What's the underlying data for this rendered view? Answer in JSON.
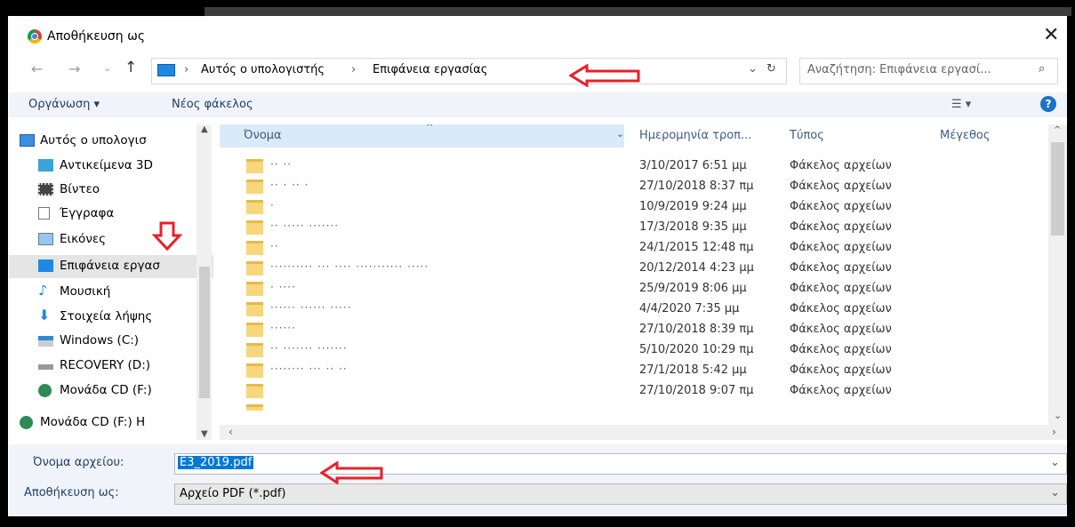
{
  "window": {
    "title": "Αποθήκευση ως"
  },
  "nav": {
    "path": [
      "Αυτός ο υπολογιστής",
      "Επιφάνεια εργασίας"
    ],
    "search_placeholder": "Αναζήτηση: Επιφάνεια εργασί..."
  },
  "toolbar": {
    "organize_label": "Οργάνωση ▾",
    "new_folder_label": "Νέος φάκελος"
  },
  "sidebar": {
    "items": [
      {
        "label": "Αυτός ο υπολογισ",
        "icon": "computer-icon"
      },
      {
        "label": "Αντικείμενα 3D",
        "icon": "cube-3d-icon"
      },
      {
        "label": "Βίντεο",
        "icon": "film-icon"
      },
      {
        "label": "Έγγραφα",
        "icon": "document-icon"
      },
      {
        "label": "Εικόνες",
        "icon": "picture-icon"
      },
      {
        "label": "Επιφάνεια εργασ",
        "icon": "desktop-icon"
      },
      {
        "label": "Μουσική",
        "icon": "music-icon"
      },
      {
        "label": "Στοιχεία λήψης",
        "icon": "download-icon"
      },
      {
        "label": "Windows (C:)",
        "icon": "windows-drive-icon"
      },
      {
        "label": "RECOVERY (D:)",
        "icon": "drive-icon"
      },
      {
        "label": "Μονάδα CD (F:)",
        "icon": "cd-drive-icon"
      },
      {
        "label": "Μονάδα CD (F:) H",
        "icon": "cd-drive-icon"
      }
    ]
  },
  "list": {
    "columns": [
      "Όνομα",
      "Ημερομηνία τροπ...",
      "Τύπος",
      "Μέγεθος"
    ],
    "rows": [
      {
        "name": "·· ··",
        "date": "3/10/2017 6:51 μμ",
        "type": "Φάκελος αρχείων"
      },
      {
        "name": "·· ·  ·· ·",
        "date": "27/10/2018 8:37 πμ",
        "type": "Φάκελος αρχείων"
      },
      {
        "name": "·",
        "date": "10/9/2019 9:24 μμ",
        "type": "Φάκελος αρχείων"
      },
      {
        "name": "·· ····· ·······",
        "date": "17/3/2018 9:35 μμ",
        "type": "Φάκελος αρχείων"
      },
      {
        "name": "··",
        "date": "24/1/2015 12:48 πμ",
        "type": "Φάκελος αρχείων"
      },
      {
        "name": "·········· ··· ···· ··········· ·····",
        "date": "20/12/2014 4:23 μμ",
        "type": "Φάκελος αρχείων"
      },
      {
        "name": "· ····",
        "date": "25/9/2019 8:06 μμ",
        "type": "Φάκελος αρχείων"
      },
      {
        "name": "······ ······ ·····",
        "date": "4/4/2020 7:35 μμ",
        "type": "Φάκελος αρχείων"
      },
      {
        "name": "······",
        "date": "27/10/2018 8:39 πμ",
        "type": "Φάκελος αρχείων"
      },
      {
        "name": "·· ······· ·······",
        "date": "5/10/2020 10:29 πμ",
        "type": "Φάκελος αρχείων"
      },
      {
        "name": "········ ··· ·· ··",
        "date": "27/1/2018 5:42 μμ",
        "type": "Φάκελος αρχείων"
      },
      {
        "name": "",
        "date": "27/10/2018 9:07 πμ",
        "type": "Φάκελος αρχείων"
      }
    ]
  },
  "bottom": {
    "filename_label": "Όνομα αρχείου:",
    "filename_value": "E3_2019.pdf",
    "savetype_label": "Αποθήκευση ως:",
    "savetype_value": "Αρχείο PDF (*.pdf)"
  },
  "colors": {
    "annotation_red": "#e8202a",
    "selection_blue": "#0078d7"
  }
}
